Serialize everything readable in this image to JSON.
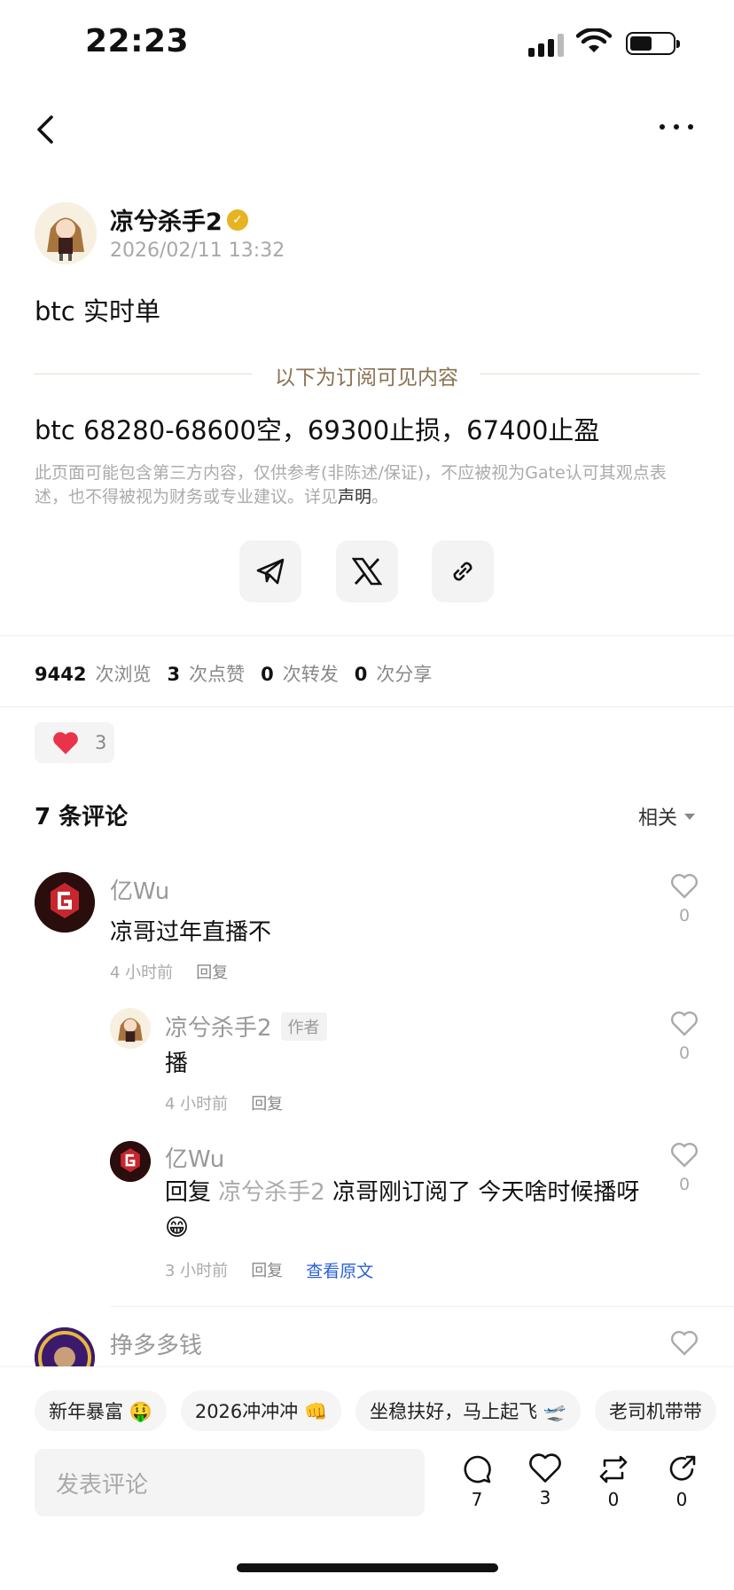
{
  "status_bar": {
    "time": "22:23"
  },
  "post": {
    "author_name": "凉兮杀手2",
    "date": "2026/02/11 13:32",
    "title": "btc 实时单",
    "subscriber_divider": "以下为订阅可见内容",
    "body": "btc 68280-68600空，69300止损，67400止盈",
    "disclaimer": "此页面可能包含第三方内容，仅供参考(非陈述/保证)，不应被视为Gate认可其观点表述，也不得被视为财务或专业建议。详见",
    "disclaimer_link": "声明",
    "disclaimer_end": "。"
  },
  "stats": {
    "views": "9442",
    "views_label": "次浏览",
    "likes": "3",
    "likes_label": "次点赞",
    "reposts": "0",
    "reposts_label": "次转发",
    "shares": "0",
    "shares_label": "次分享"
  },
  "reaction": {
    "count": "3"
  },
  "comments_header": {
    "title": "7 条评论",
    "sort": "相关"
  },
  "comments": [
    {
      "name": "亿Wu",
      "text": "凉哥过年直播不",
      "time": "4 小时前",
      "reply": "回复",
      "likes": "0"
    },
    {
      "name": "凉兮杀手2",
      "tag": "作者",
      "text": "播",
      "time": "4 小时前",
      "reply": "回复",
      "likes": "0"
    },
    {
      "name": "亿Wu",
      "reply_prefix": "回复",
      "reply_to": "凉兮杀手2",
      "text": "凉哥刚订阅了 今天啥时候播呀",
      "emoji": "😁",
      "time": "3 小时前",
      "reply": "回复",
      "view_original": "查看原文",
      "likes": "0"
    },
    {
      "name": "挣多多钱"
    }
  ],
  "quick_replies": [
    "新年暴富 🤑",
    "2026冲冲冲 👊",
    "坐稳扶好，马上起飞 🛫",
    "老司机带带"
  ],
  "bottom": {
    "placeholder": "发表评论",
    "comments": "7",
    "likes": "3",
    "reposts": "0",
    "shares": "0"
  },
  "colors": {
    "accent_gold": "#8b7252",
    "like_red": "#e8334a",
    "link_blue": "#2a5fd6"
  }
}
